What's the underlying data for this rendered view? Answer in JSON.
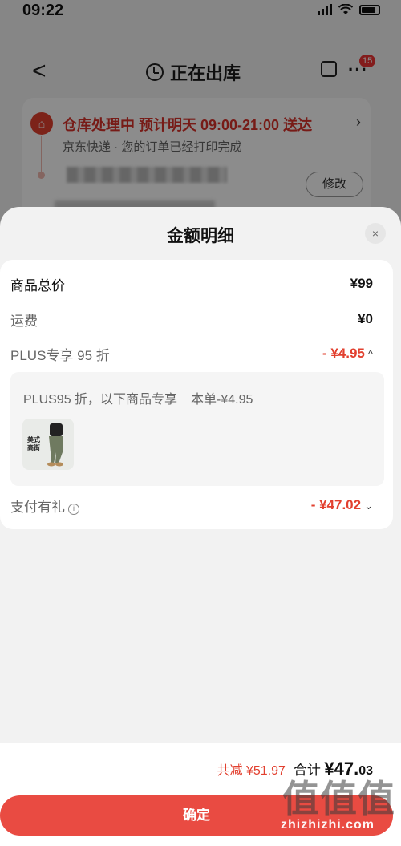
{
  "status_bar": {
    "time": "09:22"
  },
  "nav": {
    "back": "<",
    "title": "正在出库",
    "badge": "15",
    "more": "···"
  },
  "tracking": {
    "title": "仓库处理中  预计明天 09:00-21:00 送达",
    "subtitle": "京东快递 · 您的订单已经打印完成",
    "edit_label": "修改",
    "house_glyph": "⌂",
    "chevron": "›"
  },
  "sheet": {
    "title": "金额明细",
    "close": "×",
    "rows": {
      "goods_total": {
        "label": "商品总价",
        "value": "¥99"
      },
      "shipping": {
        "label": "运费",
        "value": "¥0"
      },
      "plus_discount": {
        "label": "PLUS专享 95 折",
        "value": "- ¥4.95",
        "caret": "^"
      },
      "pay_gift": {
        "label": "支付有礼",
        "value": "- ¥47.02",
        "caret": "⌄",
        "info": "i"
      }
    },
    "plus_box": {
      "desc": "PLUS95 折，以下商品专享",
      "single": "本单-¥4.95",
      "thumb_text": "美式 高街"
    }
  },
  "footer": {
    "saved": "共减 ¥51.97",
    "total_label": "合计",
    "total_int": "¥47.",
    "total_dec": "03",
    "confirm": "确定",
    "watermark": "值值值",
    "watermark_url": "zhizhizhi.com"
  },
  "colors": {
    "accent": "#e2402f",
    "button": "#e94b42"
  }
}
